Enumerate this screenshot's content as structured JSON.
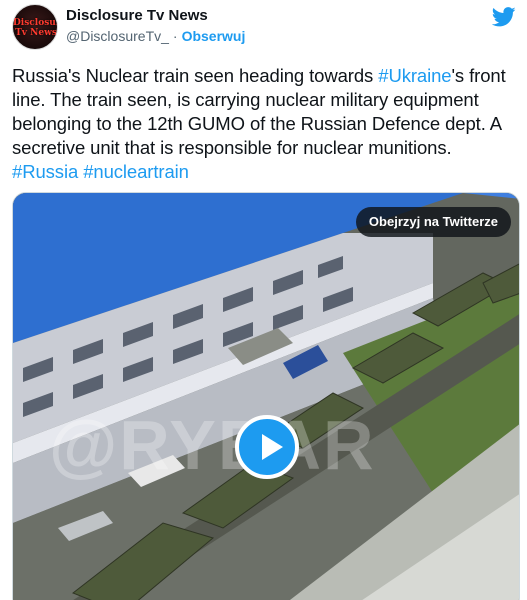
{
  "tweet": {
    "avatar_text": "Disclosure Tv News",
    "display_name": "Disclosure Tv News",
    "handle": "@DisclosureTv_",
    "separator": "·",
    "follow_label": "Obserwuj",
    "icon": "twitter-bird-icon",
    "text_parts": [
      "Russia's Nuclear train seen heading towards ",
      "#Ukraine",
      "'s front line. The train seen, is carrying  nuclear military equipment belonging to the 12th GUMO of the Russian Defence dept. A secretive unit that is responsible for nuclear munitions. ",
      "#Russia",
      " ",
      "#nucleartrain"
    ]
  },
  "media": {
    "watch_label": "Obejrzyj na Twitterze",
    "watermark": "@RYBAR",
    "play_icon": "play-icon"
  },
  "colors": {
    "accent": "#1d9bf0",
    "text": "#0f1419",
    "secondary": "#536471"
  }
}
